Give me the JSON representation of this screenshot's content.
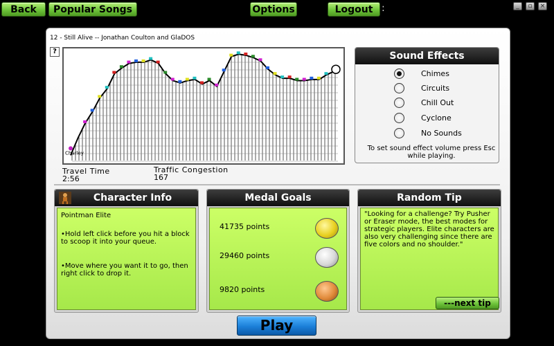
{
  "topbar": {
    "back_label": "Back",
    "popular_label": "Popular Songs",
    "options_label": "Options",
    "logout_label": "Logout",
    "colon": ":"
  },
  "window_controls": [
    "minimize-icon",
    "restore-icon",
    "close-icon"
  ],
  "song": {
    "title": "12 - Still Alive -- Jonathan Coulton and GlaDOS"
  },
  "graph": {
    "help_label": "?",
    "start_label": "Charley",
    "track_y_values": [
      0.93,
      0.78,
      0.65,
      0.55,
      0.43,
      0.35,
      0.22,
      0.17,
      0.13,
      0.12,
      0.12,
      0.1,
      0.13,
      0.22,
      0.28,
      0.3,
      0.28,
      0.27,
      0.31,
      0.28,
      0.33,
      0.2,
      0.07,
      0.05,
      0.06,
      0.08,
      0.11,
      0.18,
      0.23,
      0.26,
      0.26,
      0.28,
      0.28,
      0.27,
      0.27,
      0.23,
      0.2
    ]
  },
  "stats": {
    "travel_time_label": "Travel Time",
    "travel_time_value": "2:56",
    "traffic_label": "Traffic Congestion",
    "traffic_value": "167"
  },
  "sound_effects": {
    "title": "Sound Effects",
    "options": [
      "Chimes",
      "Circuits",
      "Chill Out",
      "Cyclone",
      "No Sounds"
    ],
    "selected": "Chimes",
    "note": "To set sound effect volume press Esc while playing."
  },
  "character_info": {
    "title": "Character Info",
    "name": "Pointman Elite",
    "tip1": "•Hold left click before you hit a block to scoop it into your queue.",
    "tip2": "•Move where you want it to go, then right click to drop it."
  },
  "medal_goals": {
    "title": "Medal Goals",
    "goals": [
      {
        "points": "41735 points",
        "medal": "gold",
        "color": "#e8d020"
      },
      {
        "points": "29460 points",
        "medal": "silver",
        "color": "#d8d8d8"
      },
      {
        "points": "9820 points",
        "medal": "bronze",
        "color": "#e08a3a"
      }
    ]
  },
  "random_tip": {
    "title": "Random Tip",
    "text": "\"Looking for a challenge? Try Pusher or Eraser mode, the best modes for strategic players. Elite characters are also very challenging since there are five colors and no shoulder.\"",
    "next_label": "---next tip"
  },
  "play_label": "Play",
  "colors": {
    "green_button": "#6ec43a",
    "panel_green": "#b5f055",
    "play_blue": "#1b7fd8",
    "header_dark": "#1e1e1e"
  }
}
